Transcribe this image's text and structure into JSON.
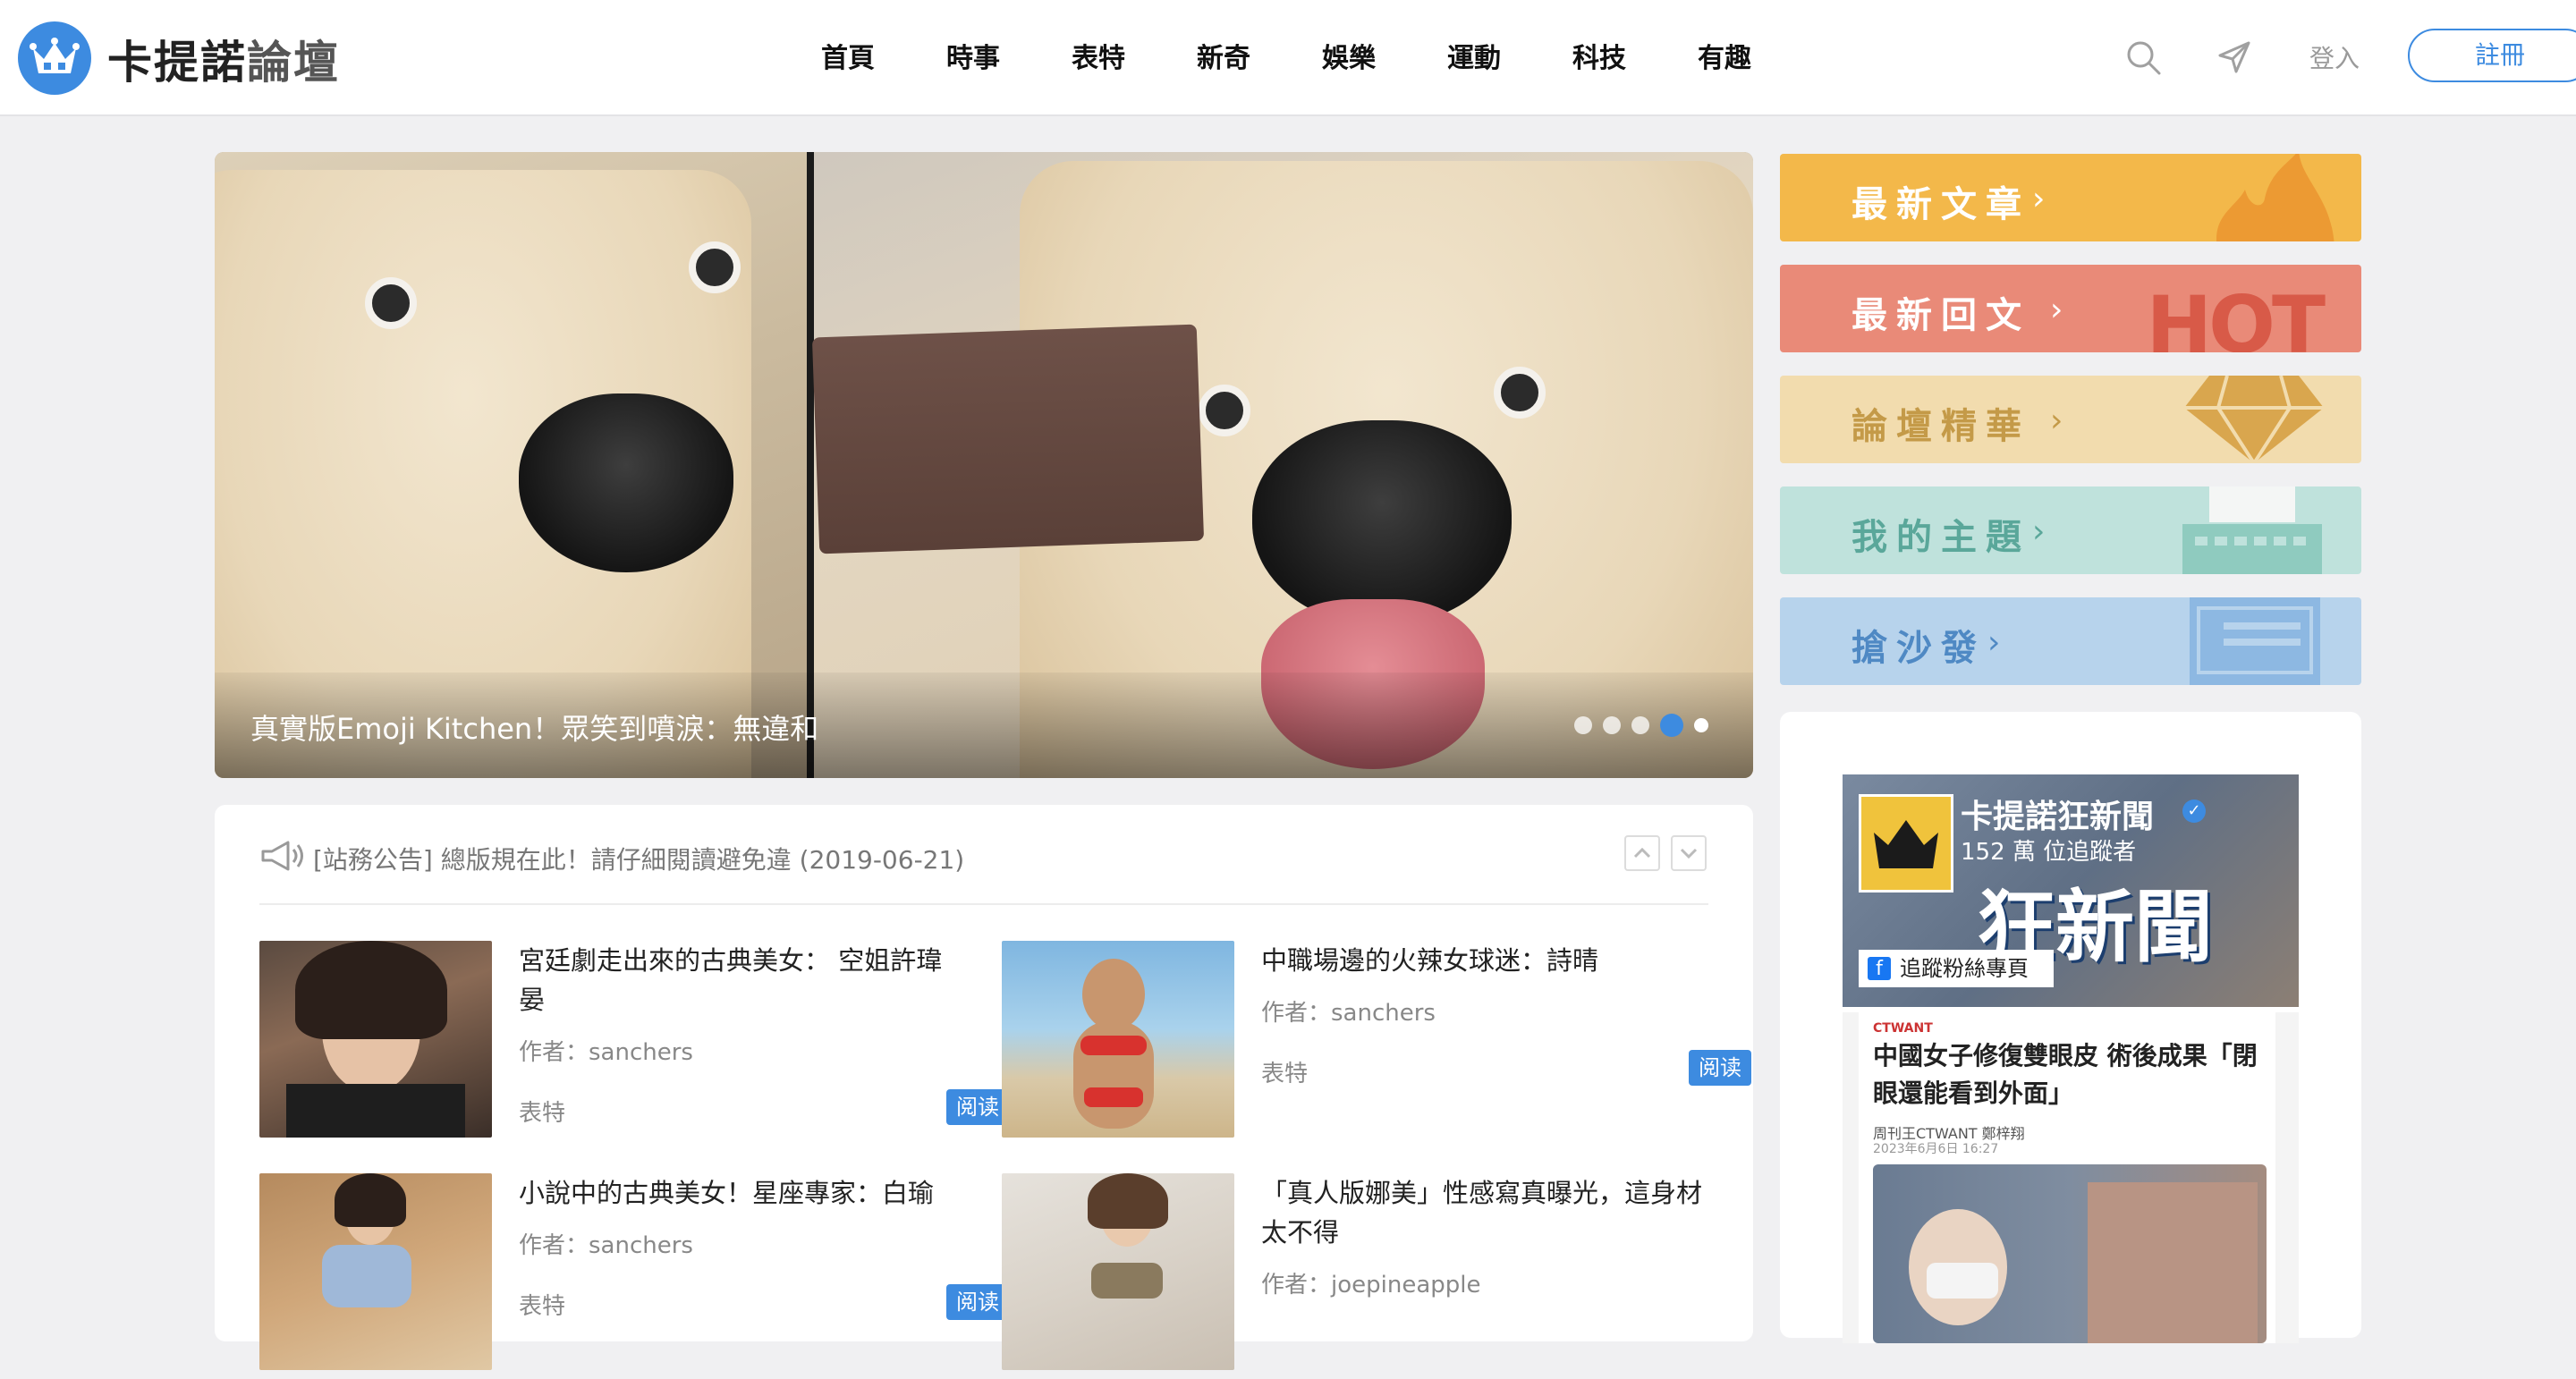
{
  "header": {
    "brand_part1": "卡提諾",
    "brand_part2": "論壇",
    "nav": [
      "首頁",
      "時事",
      "表特",
      "新奇",
      "娛樂",
      "運動",
      "科技",
      "有趣"
    ],
    "login_label": "登入",
    "register_label": "註冊"
  },
  "hero": {
    "caption": "真實版Emoji Kitchen！眾笑到噴淚：無違和",
    "slide_count": 5,
    "active_slide": 4
  },
  "announcement": {
    "text": "[站務公告] 總版規在此！請仔細閱讀避免違 (2019-06-21)"
  },
  "articles": [
    {
      "title": "宮廷劇走出來的古典美女： 空姐許瑋晏",
      "author": "作者：sanchers",
      "category": "表特",
      "read_label": "阅读"
    },
    {
      "title": "中職場邊的火辣女球迷：詩晴",
      "author": "作者：sanchers",
      "category": "表特",
      "read_label": "阅读"
    },
    {
      "title": "小說中的古典美女！星座專家：白瑜",
      "author": "作者：sanchers",
      "category": "表特",
      "read_label": "阅读"
    },
    {
      "title": "「真人版娜美」性感寫真曝光，這身材太不得",
      "author": "作者：joepineapple",
      "category": "",
      "read_label": ""
    }
  ],
  "sidebar": {
    "buttons": [
      {
        "label": "最新文章",
        "color": "#f3b84a"
      },
      {
        "label": "最新回文",
        "color": "#e98a78"
      },
      {
        "label": "論壇精華",
        "color": "#f2dcae"
      },
      {
        "label": "我的主題",
        "color": "#bfe2dc"
      },
      {
        "label": "搶沙發",
        "color": "#b7d3ec"
      }
    ],
    "hot_text": "HOT"
  },
  "facebook": {
    "page_name": "卡提諾狂新聞",
    "followers": "152 萬 位追蹤者",
    "big_title": "狂新聞",
    "follow_label": "追蹤粉絲專頁",
    "post": {
      "source": "CTWANT",
      "title": "中國女子修復雙眼皮 術後成果「閉眼還能看到外面」",
      "meta": "周刊王CTWANT 鄭梓翔",
      "date": "2023年6月6日 16:27"
    }
  },
  "colors": {
    "accent": "#3d8be0",
    "background": "#f0f0f2"
  }
}
